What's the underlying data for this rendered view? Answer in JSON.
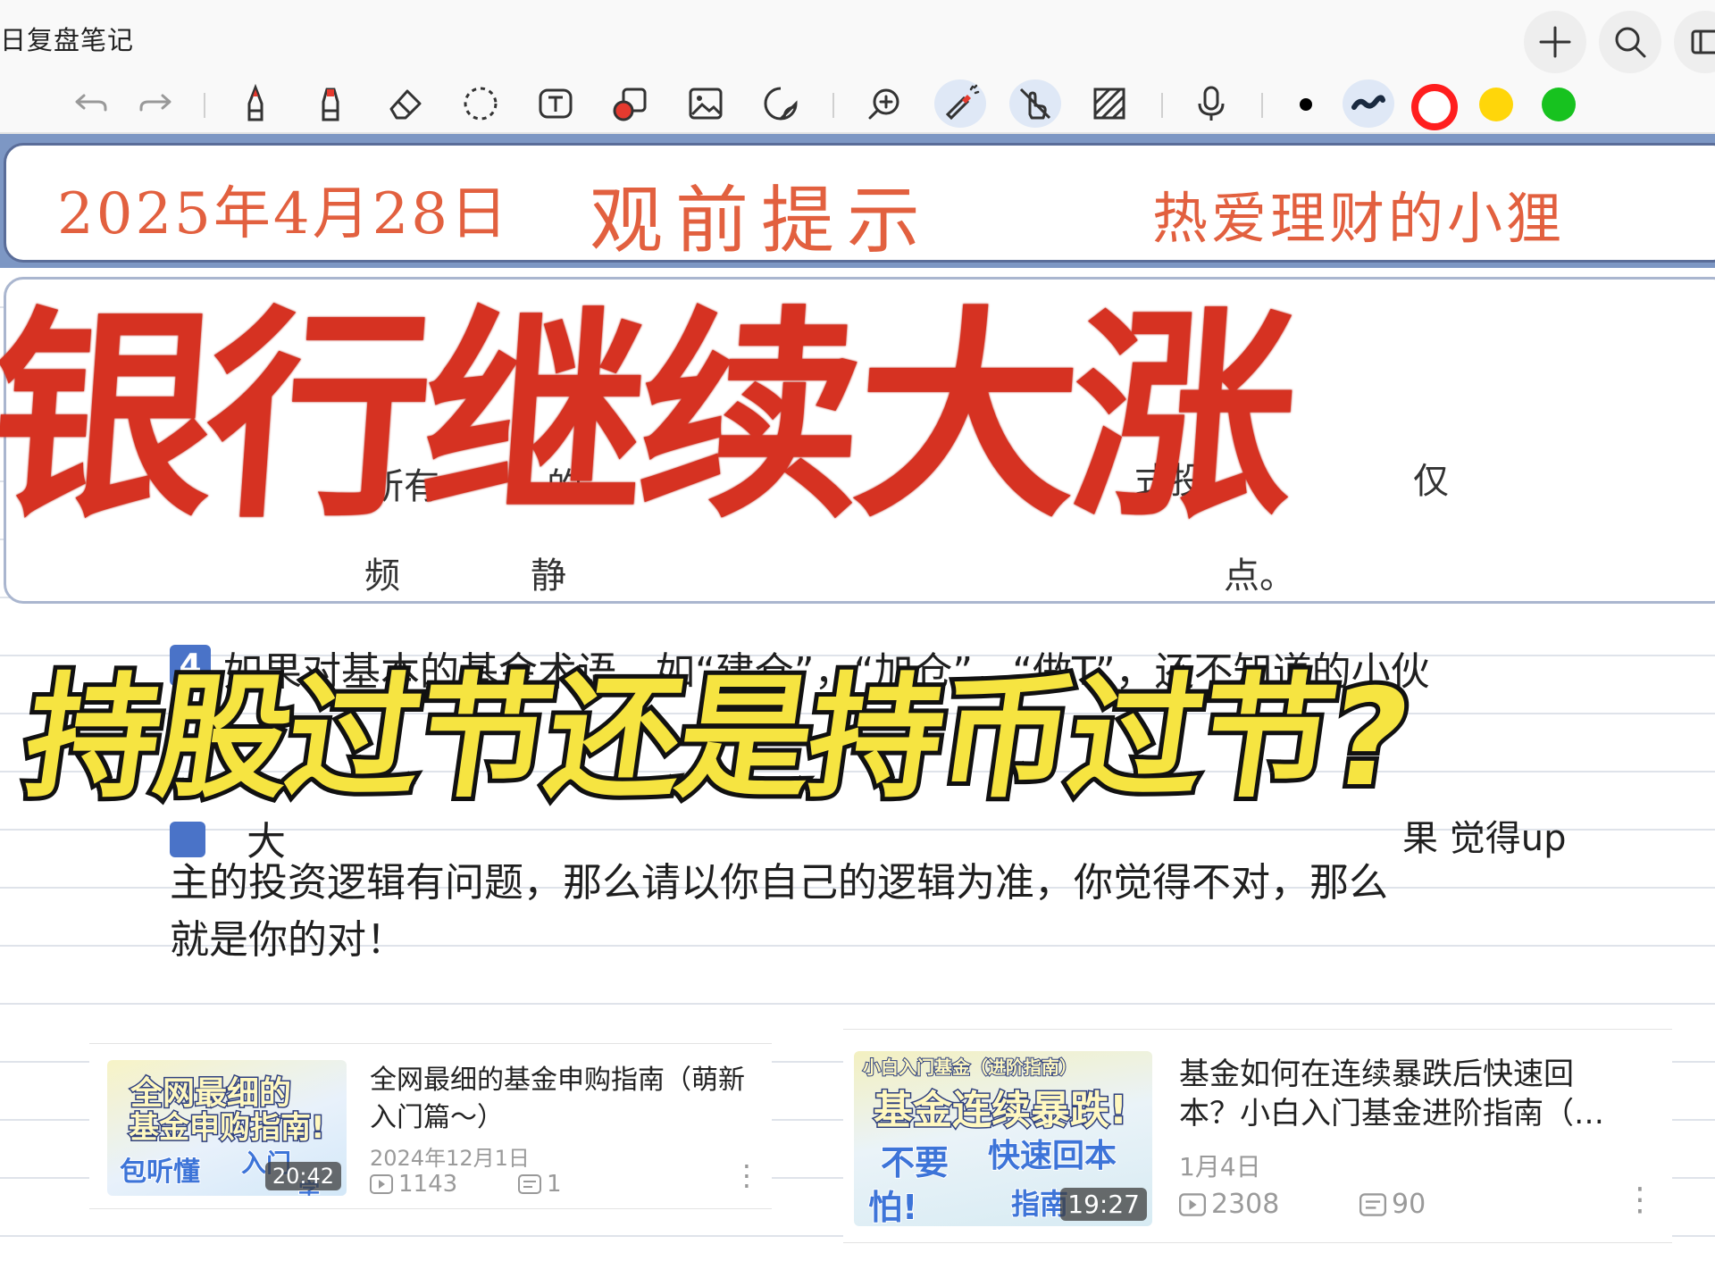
{
  "app": {
    "title": "日复盘笔记",
    "buttons": [
      "add-icon",
      "search-icon",
      "panel-icon"
    ]
  },
  "toolbar": {
    "tools": [
      "undo-icon",
      "redo-icon",
      "pen-icon",
      "marker-icon",
      "eraser-icon",
      "lasso-icon",
      "text-box-icon",
      "shape-icon",
      "image-icon",
      "sticker-icon",
      "zoom-icon",
      "laser-pointer-icon",
      "touch-draw-icon",
      "background-pattern-icon",
      "microphone-icon"
    ],
    "colors": [
      "#000000",
      "#1a2a40",
      "#ff1e1e",
      "#ffd60a",
      "#17c21f"
    ]
  },
  "header": {
    "date": "2025年4月28日",
    "tip": "观前提示",
    "author": "热爱理财的小狸"
  },
  "overlay": {
    "red_title": "银行继续大涨",
    "yellow_title": "持股过节还是持币过节?"
  },
  "notes": {
    "fragments": [
      "所有",
      "的",
      "式投",
      "仅",
      "频",
      "静",
      "点。"
    ],
    "item4_number": "4",
    "item4_text": "如果对基本的基金术语，如“建仓”，“加仓”，“做T”，还不知道的小伙",
    "item5_partial": "大",
    "item5_right_partial": "果    觉得up",
    "item5_line2": "主的投资逻辑有问题，那么请以你自己的逻辑为准，你觉得不对，那么",
    "item5_line3": "就是你的对！"
  },
  "videos": [
    {
      "thumb_lines": [
        "全网最细的",
        "基金申购指南!",
        "包听懂",
        "入门",
        "学"
      ],
      "duration": "20:42",
      "title_line1": "全网最细的基金申购指南（萌新",
      "title_line2": "入门篇～）",
      "date": "2024年12月1日",
      "views": "1143",
      "comments": "1"
    },
    {
      "thumb_lines": [
        "小白入门基金（进阶指南）",
        "基金连续暴跌!",
        "不要",
        "快速回本",
        "怕!",
        "指南"
      ],
      "duration": "19:27",
      "title_line1": "基金如何在连续暴跌后快速回",
      "title_line2": "本？小白入门基金进阶指南（…",
      "date": "1月4日",
      "views": "2308",
      "comments": "90"
    }
  ]
}
